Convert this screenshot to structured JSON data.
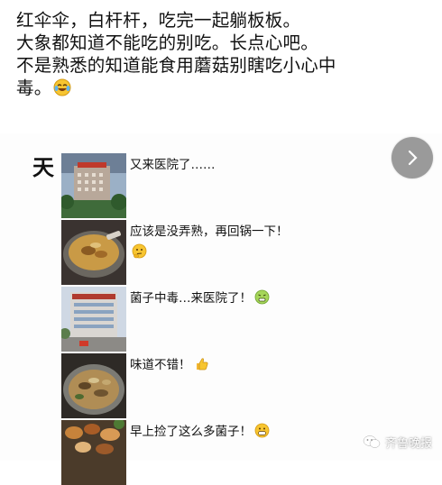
{
  "post": {
    "lines": [
      "红伞伞，白杆杆，吃完一起躺板板。",
      "大象都知道不能吃的别吃。长点心吧。",
      "不是熟悉的知道能食用蘑菇别瞎吃小心中",
      "毒。"
    ],
    "trailing_emoji": "laughing-crying-emoji"
  },
  "side_glyph": "天",
  "next_button": {
    "icon": "chevron-right-icon"
  },
  "feed": [
    {
      "caption": "又来医院了……",
      "emoji": ""
    },
    {
      "caption": "应该是没弄熟，再回锅一下！",
      "emoji": "thinking-face-emoji"
    },
    {
      "caption": "菌子中毒…来医院了！",
      "emoji": "sick-face-emoji"
    },
    {
      "caption": "味道不错！",
      "emoji": "thumbs-up-emoji"
    },
    {
      "caption": "早上捡了这么多菌子！",
      "emoji": "grinning-face-emoji"
    }
  ],
  "watermark": {
    "text": "齐鲁晚报",
    "icon": "wechat-icon"
  },
  "colors": {
    "next_button_bg": "#9a9a9a",
    "text": "#111111"
  }
}
